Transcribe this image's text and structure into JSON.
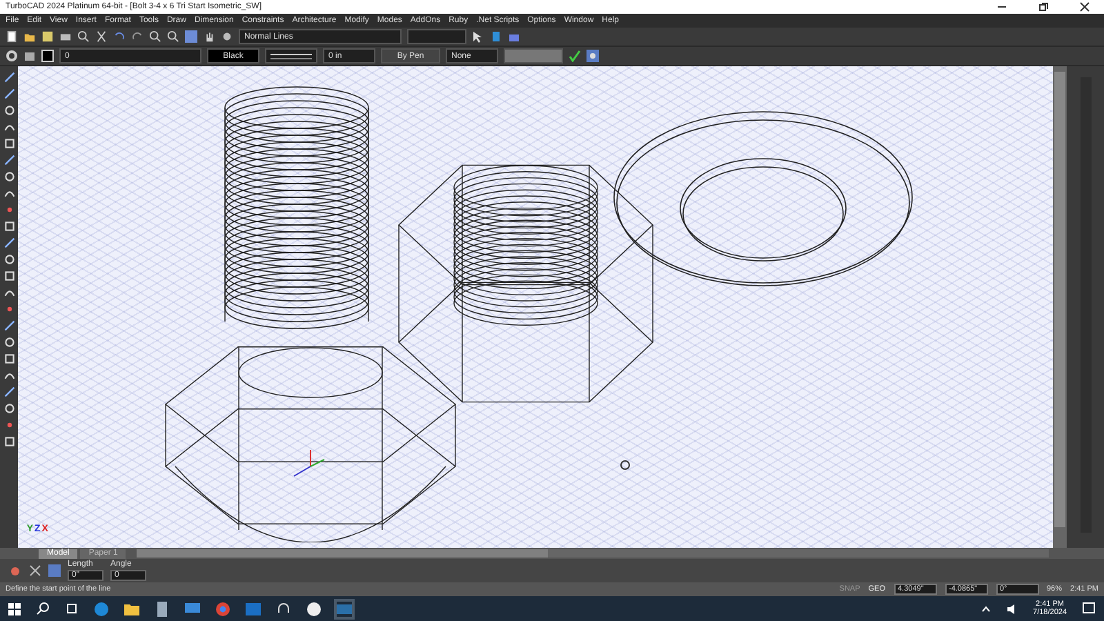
{
  "window": {
    "title": "TurboCAD 2024 Platinum 64-bit - [Bolt 3-4 x 6 Tri Start Isometric_SW]"
  },
  "menu": [
    "File",
    "Edit",
    "View",
    "Insert",
    "Format",
    "Tools",
    "Draw",
    "Dimension",
    "Constraints",
    "Architecture",
    "Modify",
    "Modes",
    "AddOns",
    "Ruby",
    ".Net Scripts",
    "Options",
    "Window",
    "Help"
  ],
  "toolbar": {
    "line_style": "Normal Lines"
  },
  "property_bar": {
    "layer": "0",
    "pen_color_setting": "Black",
    "line_width": "0 in",
    "pen": "By Pen",
    "fill": "None"
  },
  "axis_labels": [
    {
      "text": "Y",
      "color": "#2a9a2a"
    },
    {
      "text": "Z",
      "color": "#2233dd"
    },
    {
      "text": "X",
      "color": "#dd2222"
    }
  ],
  "sheet_tabs": [
    {
      "label": "Model",
      "selected": true
    },
    {
      "label": "Paper 1",
      "selected": false
    }
  ],
  "inspector": [
    {
      "label": "Length",
      "value": "0\""
    },
    {
      "label": "Angle",
      "value": "0"
    }
  ],
  "status_bar": {
    "prompt": "Define the start point of the line",
    "modes": [
      {
        "label": "SNAP",
        "on": false
      },
      {
        "label": "GEO",
        "on": true
      }
    ],
    "coords": [
      "4.3049\"",
      "-4.0865\"",
      "0°"
    ],
    "zoom": "96%",
    "time": "2:41 PM"
  },
  "taskbar": {
    "time": "2:41 PM",
    "date": "7/18/2024"
  }
}
